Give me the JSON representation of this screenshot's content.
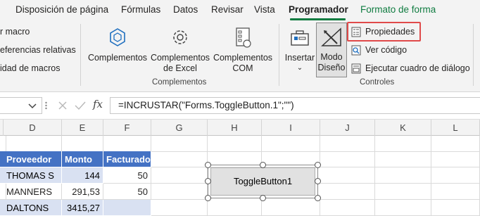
{
  "tabs": [
    "Disposición de página",
    "Fórmulas",
    "Datos",
    "Revisar",
    "Vista",
    "Programador",
    "Formato de forma"
  ],
  "ribbon": {
    "code_group": {
      "items": [
        "r macro",
        "eferencias relativas",
        "idad de macros"
      ]
    },
    "complementos_group": {
      "buttons": [
        {
          "line1": "Complementos",
          "line2": ""
        },
        {
          "line1": "Complementos",
          "line2": "de Excel"
        },
        {
          "line1": "Complementos",
          "line2": "COM"
        }
      ],
      "label": "Complementos"
    },
    "controles_group": {
      "insertar": "Insertar",
      "modo_line1": "Modo",
      "modo_line2": "Diseño",
      "propiedades": "Propiedades",
      "ver_codigo": "Ver código",
      "ejecutar": "Ejecutar cuadro de diálogo",
      "label": "Controles"
    }
  },
  "formula_bar": {
    "fx": "fx",
    "formula": "=INCRUSTAR(\"Forms.ToggleButton.1\";\"\")"
  },
  "columns": [
    "D",
    "E",
    "F",
    "G",
    "H",
    "I",
    "J",
    "K",
    "L"
  ],
  "table": {
    "headers": [
      "Proveedor",
      "Monto",
      "Facturado"
    ],
    "rows": [
      [
        "THOMAS S",
        "144",
        "50"
      ],
      [
        "MANNERS",
        "291,53",
        "50"
      ],
      [
        "DALTONS",
        "3415,27",
        ""
      ]
    ]
  },
  "toggle_button": {
    "label": "ToggleButton1"
  },
  "colors": {
    "accent": "#107c41",
    "table_header": "#4472c4",
    "table_row": "#d9e1f2",
    "highlight": "#e04a4a"
  }
}
